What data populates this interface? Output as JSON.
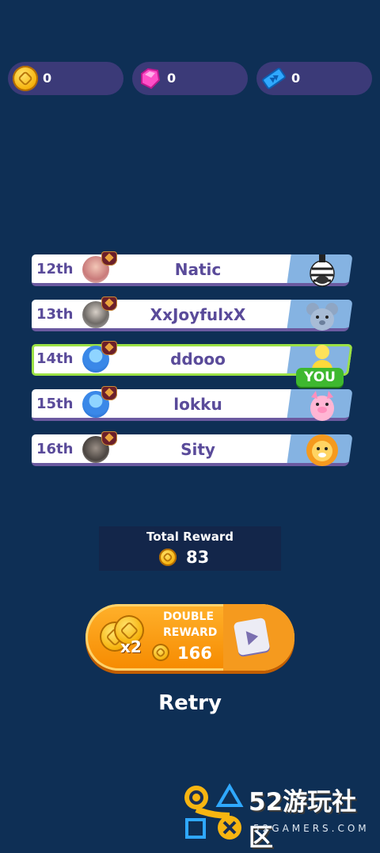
{
  "currencies": [
    {
      "icon": "coin-icon",
      "value": "0"
    },
    {
      "icon": "gem-icon",
      "value": "0"
    },
    {
      "icon": "ticket-icon",
      "value": "0"
    }
  ],
  "leaderboard": [
    {
      "rank": "12th",
      "name": "Natic",
      "pet": "zebra"
    },
    {
      "rank": "13th",
      "name": "XxJoyfulxX",
      "pet": "mouse"
    },
    {
      "rank": "14th",
      "name": "ddooo",
      "pet": "yellow-character",
      "is_you": true,
      "you_label": "YOU"
    },
    {
      "rank": "15th",
      "name": "lokku",
      "pet": "pig"
    },
    {
      "rank": "16th",
      "name": "Sity",
      "pet": "lion"
    }
  ],
  "reward": {
    "label": "Total Reward",
    "amount": "83"
  },
  "double_reward": {
    "line1": "DOUBLE",
    "line2": "REWARD",
    "multiplier": "x2",
    "amount": "166"
  },
  "retry_label": "Retry",
  "watermark": {
    "big": "52游玩社区",
    "small": "52GAMERS.COM"
  },
  "colors": {
    "background": "#0e2f55",
    "accent": "#f68a00",
    "highlight": "#9be145"
  }
}
